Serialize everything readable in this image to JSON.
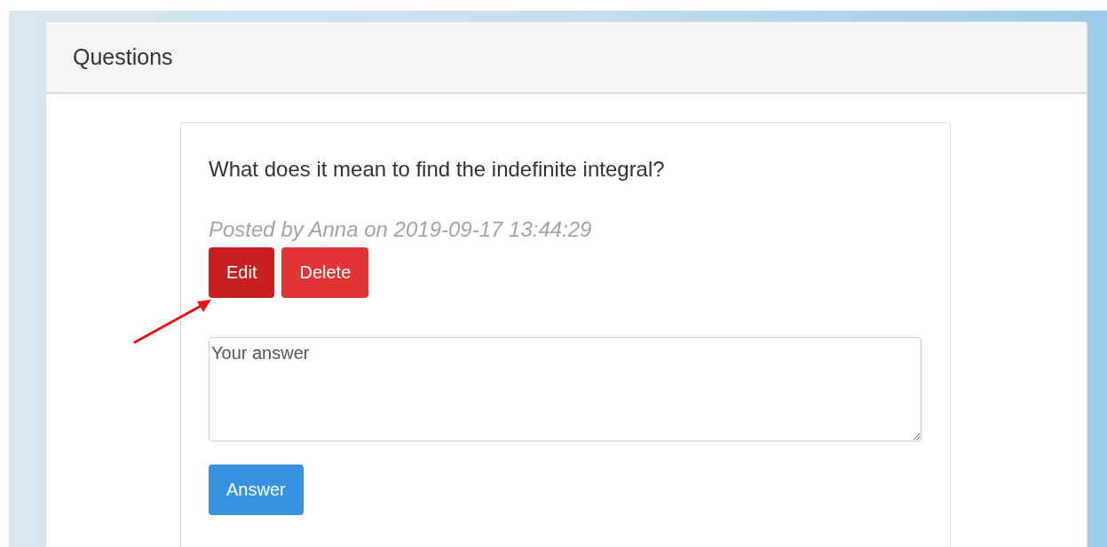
{
  "panel": {
    "title": "Questions"
  },
  "question": {
    "text": "What does it mean to find the indefinite integral?",
    "meta": "Posted by Anna on 2019-09-17 13:44:29",
    "buttons": [
      {
        "label": "Edit",
        "kind": "danger",
        "active": true
      },
      {
        "label": "Delete",
        "kind": "danger",
        "active": false
      }
    ],
    "answer": {
      "placeholder": "Your answer"
    },
    "submit": {
      "label": "Answer",
      "kind": "primary",
      "active": false
    }
  },
  "annotation": {
    "arrow_shown": true
  }
}
